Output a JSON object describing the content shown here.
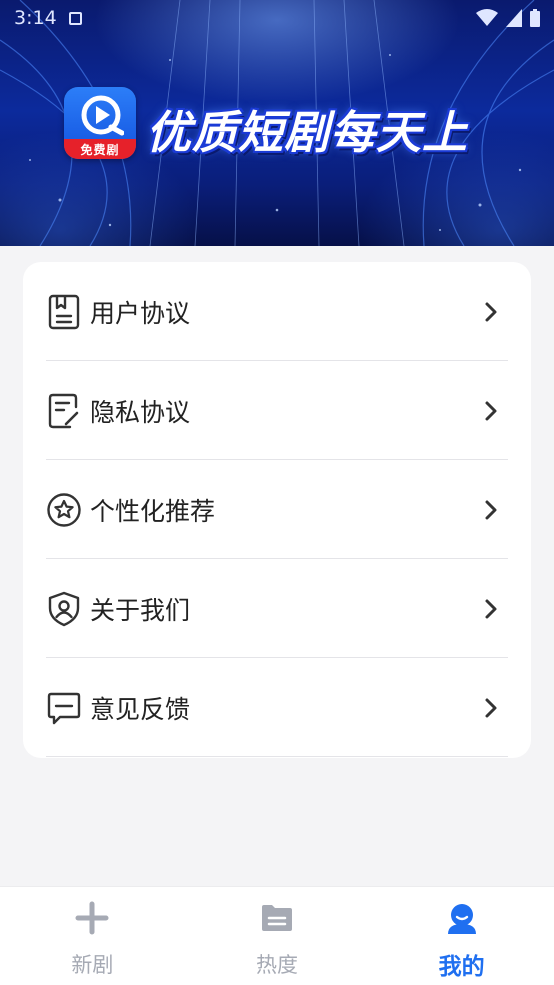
{
  "status_bar": {
    "time": "3:14"
  },
  "banner": {
    "logo_badge": "免费剧",
    "slogan": "优质短剧每天上"
  },
  "menu": {
    "items": [
      {
        "label": "用户协议",
        "icon": "document-bookmark-icon"
      },
      {
        "label": "隐私协议",
        "icon": "edit-document-icon"
      },
      {
        "label": "个性化推荐",
        "icon": "star-circle-icon"
      },
      {
        "label": "关于我们",
        "icon": "shield-user-icon"
      },
      {
        "label": "意见反馈",
        "icon": "message-icon"
      }
    ]
  },
  "tabbar": {
    "tabs": [
      {
        "label": "新剧",
        "icon": "plus-icon",
        "active": false
      },
      {
        "label": "热度",
        "icon": "folder-icon",
        "active": false
      },
      {
        "label": "我的",
        "icon": "user-icon",
        "active": true
      }
    ]
  },
  "colors": {
    "accent": "#1f6ff0",
    "tab_inactive": "#a6aab4",
    "background": "#f4f4f6",
    "logo_red": "#e6212a"
  }
}
